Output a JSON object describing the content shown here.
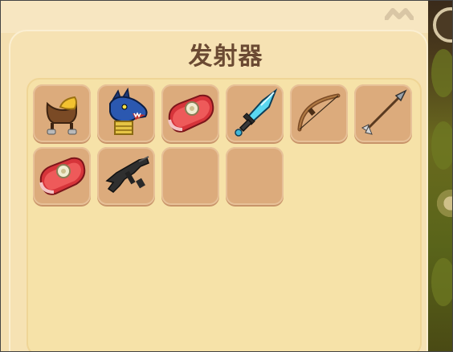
{
  "panel": {
    "title": "发射器"
  },
  "inventory": {
    "slots": [
      {
        "item": "saddle-icon"
      },
      {
        "item": "dragon-head-icon"
      },
      {
        "item": "raw-meat-icon"
      },
      {
        "item": "crystal-sword-icon"
      },
      {
        "item": "bow-icon"
      },
      {
        "item": "arrow-icon"
      },
      {
        "item": "raw-meat-icon"
      },
      {
        "item": "submachine-gun-icon"
      },
      {
        "item": "empty"
      },
      {
        "item": "empty"
      }
    ]
  },
  "colors": {
    "panel_bg": "#f6e2b3",
    "slot_bg": "#dcab7c",
    "title": "#6b4a33"
  }
}
